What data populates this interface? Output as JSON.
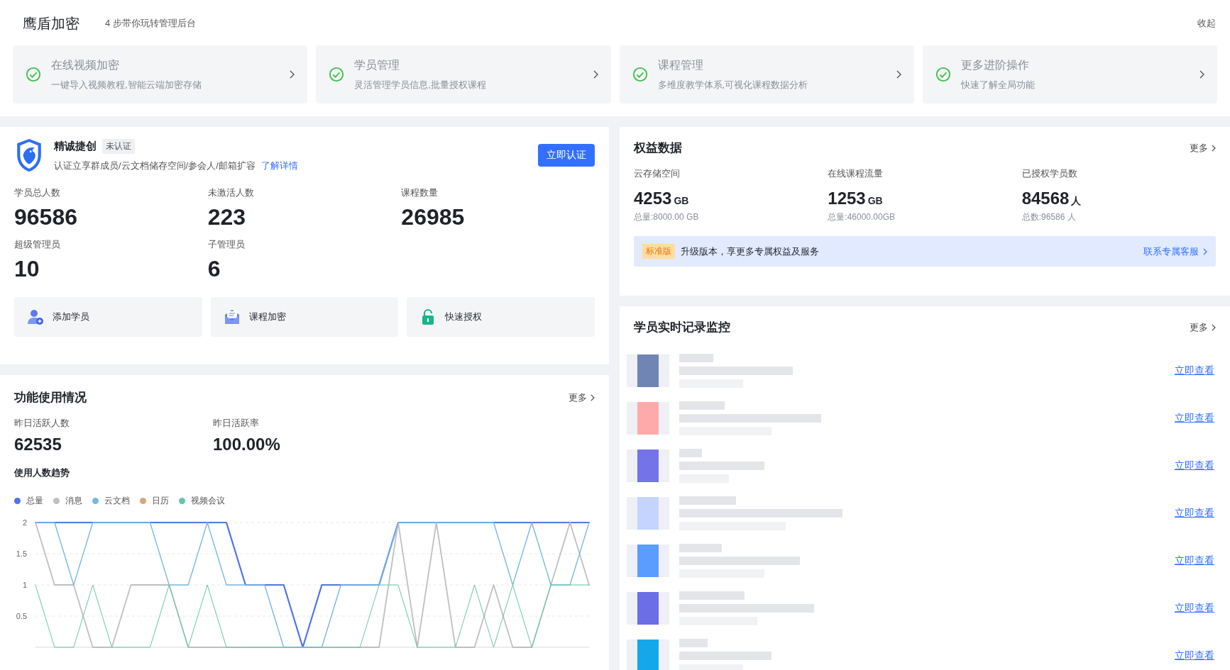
{
  "header": {
    "title": "鹰盾加密",
    "subtitle": "4 步带你玩转管理后台",
    "collapse": "收起"
  },
  "steps": [
    {
      "title": "在线视频加密",
      "desc": "一键导入视频教程,智能云端加密存储",
      "done": true
    },
    {
      "title": "学员管理",
      "desc": "灵活管理学员信息,批量授权课程",
      "done": true
    },
    {
      "title": "课程管理",
      "desc": "多维度教学体系,可视化课程数据分析",
      "done": true
    },
    {
      "title": "更多进阶操作",
      "desc": "快速了解全局功能",
      "done": true
    }
  ],
  "org": {
    "name": "精诚捷创",
    "badge": "未认证",
    "desc": "认证立享群成员/云文档储存空间/参会人/邮箱扩容",
    "link": "了解详情",
    "button": "立即认证",
    "stats": [
      {
        "label": "学员总人数",
        "value": "96586"
      },
      {
        "label": "未激活人数",
        "value": "223"
      },
      {
        "label": "课程数量",
        "value": "26985"
      },
      {
        "label": "超级管理员",
        "value": "10"
      },
      {
        "label": "子管理员",
        "value": "6"
      }
    ],
    "actions": [
      {
        "kind": "user",
        "label": "添加学员"
      },
      {
        "kind": "mail",
        "label": "课程加密"
      },
      {
        "kind": "lock",
        "label": "快速授权"
      }
    ]
  },
  "benefits": {
    "title": "权益数据",
    "more": "更多",
    "stats": [
      {
        "label": "云存储空间",
        "value": "4253",
        "unit": "GB",
        "note": "总量:8000.00 GB"
      },
      {
        "label": "在线课程流量",
        "value": "1253",
        "unit": "GB",
        "note": "总量:46000.00GB"
      },
      {
        "label": "已授权学员数",
        "value": "84568",
        "unit": "人",
        "note": "总数:96586 人"
      }
    ],
    "banner": {
      "tag": "标准版",
      "text": "升级版本，享更多专属权益及服务",
      "link": "联系专属客服"
    }
  },
  "usage": {
    "title": "功能使用情况",
    "more": "更多",
    "stats": [
      {
        "label": "昨日活跃人数",
        "value": "62535"
      },
      {
        "label": "昨日活跃率",
        "value": "100.00%"
      }
    ],
    "trend_title": "使用人数趋势",
    "chart_data": {
      "type": "line",
      "grid": true,
      "ylim": [
        0,
        2
      ],
      "yticks": [
        0.5,
        1,
        1.5,
        2
      ],
      "series": [
        {
          "name": "总量",
          "color": "#4e74e8",
          "values": [
            2,
            2,
            2,
            2,
            2,
            2,
            2,
            2,
            2,
            2,
            2,
            1,
            1,
            1,
            0,
            1,
            1,
            1,
            1,
            2,
            2,
            2,
            2,
            2,
            2,
            2,
            2,
            2,
            2,
            2
          ]
        },
        {
          "name": "消息",
          "color": "#bfbfbf",
          "values": [
            2,
            1,
            1,
            0,
            0,
            1,
            1,
            1,
            0,
            0,
            0,
            0,
            0,
            0,
            0,
            0,
            0,
            0,
            0,
            2,
            0,
            2,
            0,
            0,
            1,
            0,
            0,
            1,
            2,
            1
          ]
        },
        {
          "name": "云文档",
          "color": "#79b8e0",
          "values": [
            2,
            2,
            1,
            2,
            2,
            2,
            2,
            1,
            1,
            2,
            1,
            1,
            1,
            0,
            0,
            0,
            1,
            1,
            1,
            2,
            2,
            2,
            2,
            2,
            2,
            1,
            2,
            1,
            1,
            2
          ]
        },
        {
          "name": "日历",
          "color": "#d4a97f",
          "values": [
            null,
            null,
            null,
            null,
            null,
            null,
            null,
            null,
            null,
            null,
            null,
            null,
            null,
            null,
            null,
            null,
            null,
            null,
            null,
            null,
            null,
            null,
            null,
            null,
            null,
            null,
            null,
            null,
            null,
            null
          ]
        },
        {
          "name": "视频会议",
          "color": "#64c8a4",
          "values": [
            1,
            0,
            0,
            1,
            0,
            0,
            0,
            1,
            0,
            1,
            0,
            0,
            0,
            0,
            0,
            0,
            0,
            0,
            1,
            1,
            0,
            0,
            0,
            1,
            0,
            1,
            0,
            1,
            1,
            1
          ]
        }
      ]
    }
  },
  "monitor": {
    "title": "学员实时记录监控",
    "more": "更多",
    "rows": [
      {
        "color": "#7085b3",
        "action": "立即查看"
      },
      {
        "color": "#ffaaaa",
        "action": "立即查看"
      },
      {
        "color": "#7474e8",
        "action": "立即查看"
      },
      {
        "color": "#c4d4ff",
        "action": "立即查看"
      },
      {
        "color": "#5b9cff",
        "action": "立即查看"
      },
      {
        "color": "#6b6ee6",
        "action": "立即查看"
      },
      {
        "color": "#14a8ea",
        "action": "立即查看"
      }
    ]
  }
}
